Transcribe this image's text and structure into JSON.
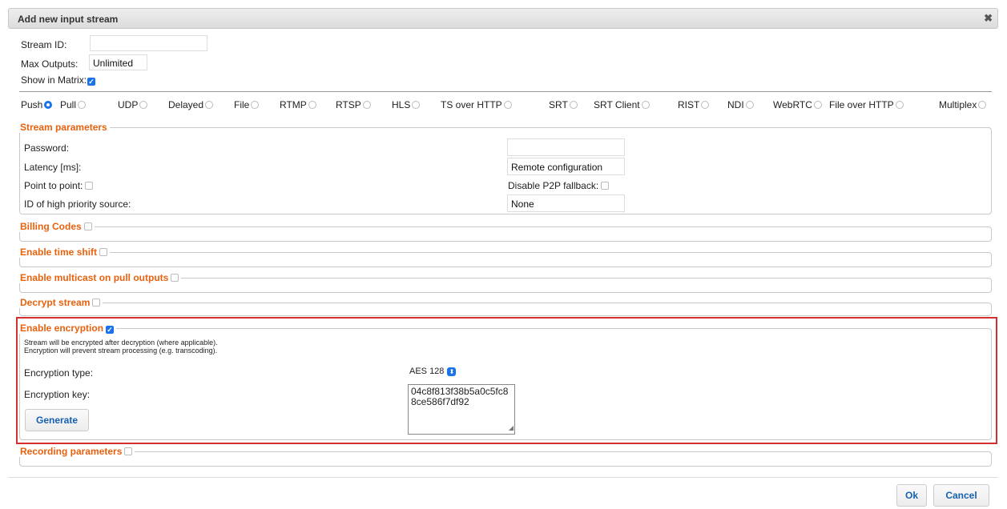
{
  "dialog": {
    "title": "Add new input stream",
    "close_glyph": "✖"
  },
  "general": {
    "stream_id_label": "Stream ID:",
    "stream_id_value": "",
    "max_outputs_label": "Max Outputs:",
    "max_outputs_value": "Unlimited",
    "show_in_matrix_label": "Show in Matrix:",
    "show_in_matrix_checked": true
  },
  "stream_types": {
    "selected": "Push",
    "options": [
      "Push",
      "Pull",
      "UDP",
      "Delayed",
      "File",
      "RTMP",
      "RTSP",
      "HLS",
      "TS over HTTP",
      "SRT",
      "SRT Client",
      "RIST",
      "NDI",
      "WebRTC",
      "File over HTTP",
      "Multiplex"
    ]
  },
  "stream_parameters": {
    "legend": "Stream parameters",
    "password_label": "Password:",
    "password_value": "",
    "latency_label": "Latency [ms]:",
    "latency_value": "Remote configuration",
    "p2p_label": "Point to point:",
    "disable_p2p_label": "Disable P2P fallback:",
    "priority_label": "ID of high priority source:",
    "priority_value": "None"
  },
  "sections": {
    "billing_codes": "Billing Codes",
    "time_shift": "Enable time shift",
    "multicast": "Enable multicast on pull outputs",
    "decrypt": "Decrypt stream",
    "recording": "Recording parameters"
  },
  "encryption": {
    "legend": "Enable encryption",
    "enabled": true,
    "note_line1": "Stream will be encrypted after decryption (where applicable).",
    "note_line2": "Encryption will prevent stream processing (e.g. transcoding).",
    "type_label": "Encryption type:",
    "type_value": "AES 128",
    "key_label": "Encryption key:",
    "key_value": "04c8f813f38b5a0c5fc88ce586f7df92",
    "generate_label": "Generate"
  },
  "footer": {
    "ok_label": "Ok",
    "cancel_label": "Cancel"
  },
  "colors": {
    "legend": "#e8610e",
    "accent": "#1a73e8",
    "highlight": "#d32f2f",
    "button_text": "#1560b0"
  }
}
